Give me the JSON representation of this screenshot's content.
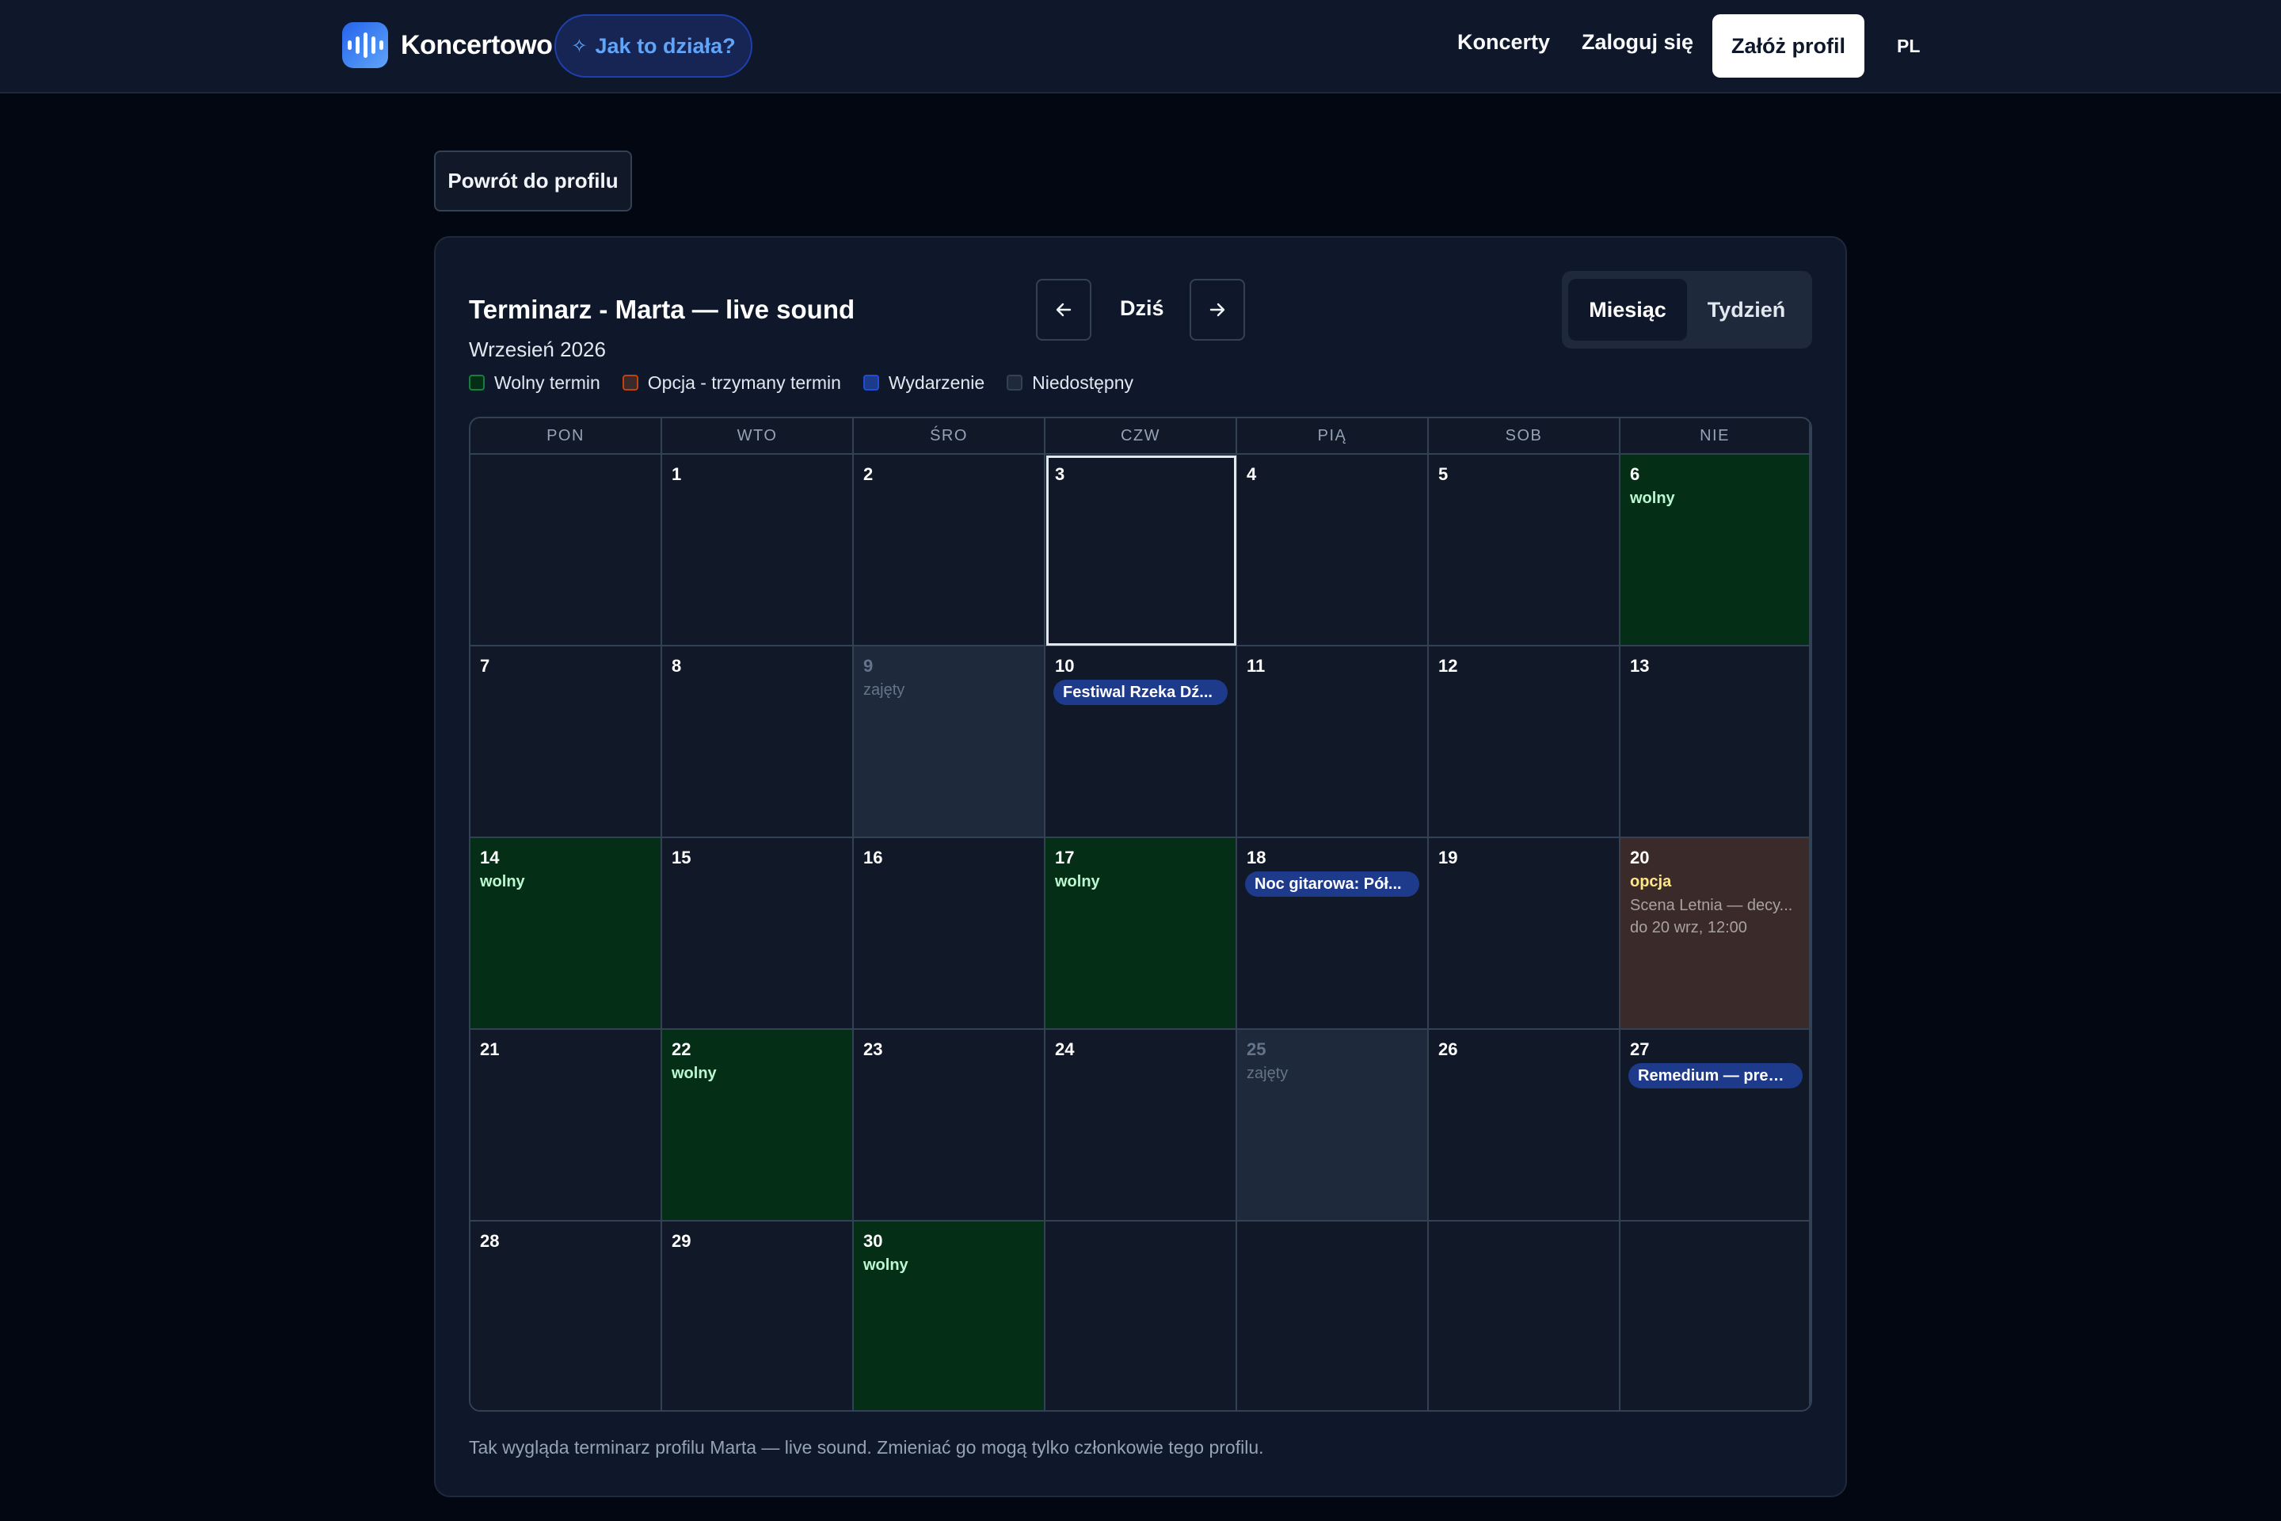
{
  "header": {
    "brand": "Koncertowo",
    "how_it_works": "Jak to działa?",
    "nav_concerts": "Koncerty",
    "nav_login": "Zaloguj się",
    "nav_signup": "Załóż profil",
    "lang": "PL"
  },
  "back_button": "Powrót do profilu",
  "calendar": {
    "title": "Terminarz - Marta — live sound",
    "month": "Wrzesień 2026",
    "today_label": "Dziś",
    "views": {
      "month": "Miesiąc",
      "week": "Tydzień",
      "active": "month"
    },
    "legend": [
      {
        "label": "Wolny termin",
        "border": "#15803d",
        "fill": "#052e16"
      },
      {
        "label": "Opcja - trzymany termin",
        "border": "#c2410c",
        "fill": "#3b2a2a"
      },
      {
        "label": "Wydarzenie",
        "border": "#1d4ed8",
        "fill": "#1e3a8a"
      },
      {
        "label": "Niedostępny",
        "border": "#334155",
        "fill": "#1e293b"
      }
    ],
    "weekdays": [
      "PON",
      "WTO",
      "ŚRO",
      "CZW",
      "PIĄ",
      "SOB",
      "NIE"
    ],
    "days": [
      {
        "num": "",
        "status": "empty"
      },
      {
        "num": "1",
        "status": "none"
      },
      {
        "num": "2",
        "status": "none"
      },
      {
        "num": "3",
        "status": "today"
      },
      {
        "num": "4",
        "status": "none"
      },
      {
        "num": "5",
        "status": "none"
      },
      {
        "num": "6",
        "status": "free",
        "label": "wolny"
      },
      {
        "num": "7",
        "status": "none"
      },
      {
        "num": "8",
        "status": "none"
      },
      {
        "num": "9",
        "status": "busy",
        "label": "zajęty"
      },
      {
        "num": "10",
        "status": "event",
        "event": "Festiwal Rzeka Dź..."
      },
      {
        "num": "11",
        "status": "none"
      },
      {
        "num": "12",
        "status": "none"
      },
      {
        "num": "13",
        "status": "none"
      },
      {
        "num": "14",
        "status": "free",
        "label": "wolny"
      },
      {
        "num": "15",
        "status": "none"
      },
      {
        "num": "16",
        "status": "none"
      },
      {
        "num": "17",
        "status": "free",
        "label": "wolny"
      },
      {
        "num": "18",
        "status": "event",
        "event": "Noc gitarowa: Pół..."
      },
      {
        "num": "19",
        "status": "none"
      },
      {
        "num": "20",
        "status": "option",
        "label": "opcja",
        "note1": "Scena Letnia — decy...",
        "note2": "do 20 wrz, 12:00"
      },
      {
        "num": "21",
        "status": "none"
      },
      {
        "num": "22",
        "status": "free",
        "label": "wolny"
      },
      {
        "num": "23",
        "status": "none"
      },
      {
        "num": "24",
        "status": "none"
      },
      {
        "num": "25",
        "status": "busy",
        "label": "zajęty"
      },
      {
        "num": "26",
        "status": "none"
      },
      {
        "num": "27",
        "status": "event",
        "event": "Remedium — prem..."
      },
      {
        "num": "28",
        "status": "none"
      },
      {
        "num": "29",
        "status": "none"
      },
      {
        "num": "30",
        "status": "free",
        "label": "wolny"
      },
      {
        "num": "",
        "status": "empty"
      },
      {
        "num": "",
        "status": "empty"
      },
      {
        "num": "",
        "status": "empty"
      },
      {
        "num": "",
        "status": "empty"
      }
    ],
    "footnote": "Tak wygląda terminarz profilu Marta — live sound. Zmieniać go mogą tylko członkowie tego profilu."
  }
}
